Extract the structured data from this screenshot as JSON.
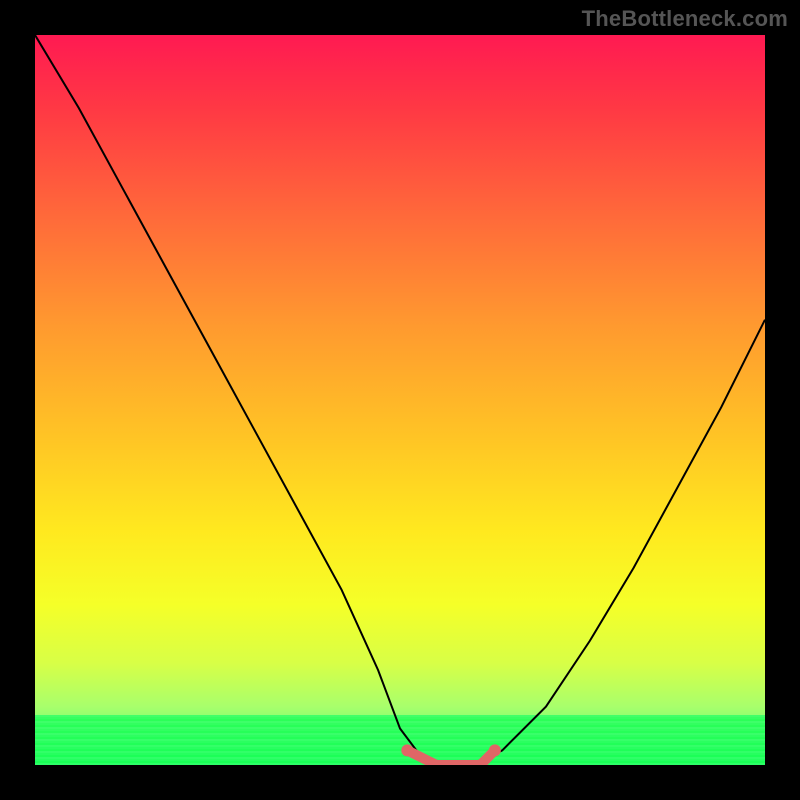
{
  "watermark": "TheBottleneck.com",
  "chart_data": {
    "type": "line",
    "title": "",
    "xlabel": "",
    "ylabel": "",
    "xlim": [
      0,
      100
    ],
    "ylim": [
      0,
      100
    ],
    "series": [
      {
        "name": "bottleneck-curve",
        "x": [
          0,
          6,
          12,
          18,
          24,
          30,
          36,
          42,
          47,
          50,
          53,
          56,
          58,
          60,
          64,
          70,
          76,
          82,
          88,
          94,
          100
        ],
        "values": [
          100,
          90,
          79,
          68,
          57,
          46,
          35,
          24,
          13,
          5,
          1,
          0,
          0,
          0,
          2,
          8,
          17,
          27,
          38,
          49,
          61
        ]
      },
      {
        "name": "optimum-highlight",
        "x": [
          51,
          53,
          55,
          57,
          59,
          61,
          63
        ],
        "values": [
          2,
          1,
          0,
          0,
          0,
          0,
          2
        ]
      }
    ],
    "annotations": [],
    "legend": [],
    "grid": false,
    "background": "heatmap-gradient red→yellow→green"
  },
  "colors": {
    "curve": "#000000",
    "highlight": "#e06666",
    "frame": "#000000"
  }
}
